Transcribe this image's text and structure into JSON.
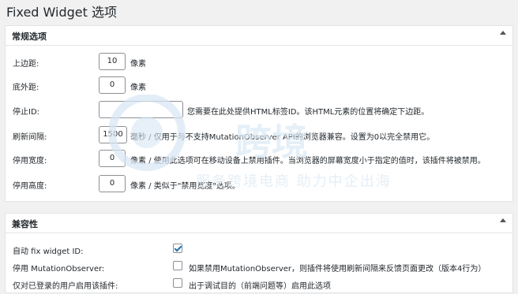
{
  "page": {
    "title": "Fixed Widget 选项"
  },
  "general": {
    "title": "常规选项",
    "rows": [
      {
        "label": "上边距:",
        "value": "10",
        "desc": "像素"
      },
      {
        "label": "底外距:",
        "value": "0",
        "desc": "像素"
      },
      {
        "label": "停止ID:",
        "value": "",
        "desc": "您需要在此处提供HTML标签ID。该HTML元素的位置将确定下边距。"
      },
      {
        "label": "刷新间隔:",
        "value": "1500",
        "desc": "毫秒 / 仅用于与不支持MutationObserver API的浏览器兼容。设置为0以完全禁用它。"
      },
      {
        "label": "停用宽度:",
        "value": "0",
        "desc": "像素 / 使用此选项可在移动设备上禁用插件。当浏览器的屏幕宽度小于指定的值时，该插件将被禁用。"
      },
      {
        "label": "停用高度:",
        "value": "0",
        "desc": "像素 / 类似于\"禁用宽度\"选项。"
      }
    ]
  },
  "compat": {
    "title": "兼容性",
    "rows": [
      {
        "label": "自动 fix widget ID:",
        "checked": true,
        "desc": ""
      },
      {
        "label": "停用 MutationObserver:",
        "checked": false,
        "desc": "如果禁用MutationObserver，则插件将使用刷新间隔来反馈页面更改（版本4行为）"
      },
      {
        "label": "仅对已登录的用户启用该插件:",
        "checked": false,
        "desc": "出于调试目的（前端问题等）启用此选项"
      }
    ]
  },
  "watermark": {
    "brand": "跨境",
    "tagline": "服务跨境电商 助力中企出海"
  },
  "colors": {
    "accent": "#2271b1",
    "panel_border": "#e2e4e7",
    "background": "#f1f1f1"
  }
}
